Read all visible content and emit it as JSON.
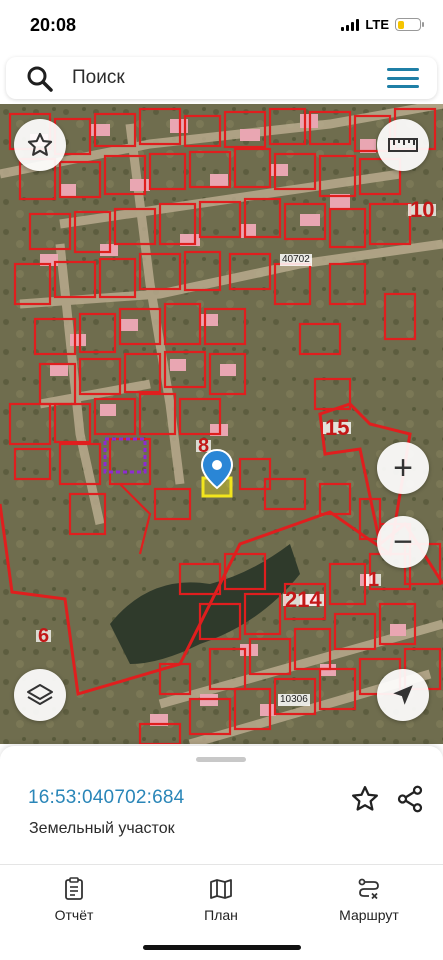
{
  "status_bar": {
    "time": "20:08",
    "network": "LTE",
    "battery_color": "#f5c400"
  },
  "search": {
    "placeholder": "Поиск",
    "icon": "search-icon",
    "menu_icon": "hamburger-menu-icon"
  },
  "map": {
    "labels": [
      {
        "id": "block-40702",
        "text": "40702"
      },
      {
        "id": "block-10306",
        "text": "10306"
      },
      {
        "id": "num-8",
        "text": "8"
      },
      {
        "id": "num-10",
        "text": "10"
      },
      {
        "id": "num-15",
        "text": "15"
      },
      {
        "id": "num-214",
        "text": "214"
      },
      {
        "id": "num-6",
        "text": "6"
      },
      {
        "id": "num-1",
        "text": "1"
      }
    ],
    "buttons": {
      "favorite": "star-icon",
      "ruler": "ruler-icon",
      "zoom_in": "+",
      "zoom_out": "−",
      "layers": "layers-icon",
      "locate": "location-arrow-icon"
    },
    "colors": {
      "parcel_outline": "#e01e1e",
      "selected_parcel": "#f2e51d",
      "pin": "#2a86d6",
      "dashed": "#8e2bd1"
    }
  },
  "sheet": {
    "cadastral_number": "16:53:040702:684",
    "type": "Земельный участок"
  },
  "tabs": [
    {
      "id": "report",
      "label": "Отчёт",
      "icon": "report-icon"
    },
    {
      "id": "plan",
      "label": "План",
      "icon": "map-icon"
    },
    {
      "id": "route",
      "label": "Маршрут",
      "icon": "route-icon"
    }
  ]
}
